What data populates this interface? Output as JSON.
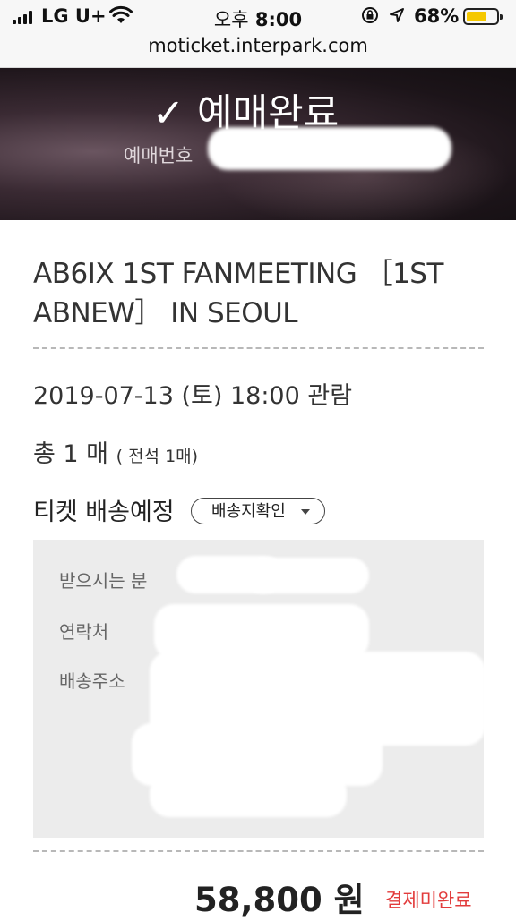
{
  "status_bar": {
    "carrier": "LG U+",
    "time_ampm": "오후",
    "time": "8:00",
    "battery_percent": "68%",
    "battery_level": 0.68,
    "battery_color": "#f5c800"
  },
  "browser": {
    "url": "moticket.interpark.com"
  },
  "header": {
    "check_mark": "✓",
    "title": "예매완료",
    "order_number_label": "예매번호"
  },
  "ticket": {
    "event_title": "AB6IX 1ST FANMEETING ［1ST ABNEW］ IN SEOUL",
    "date_time": "2019-07-13 (토) 18:00 관람",
    "count_main": "총 1 매",
    "count_sub": "( 전석 1매)",
    "delivery_label": "티켓 배송예정",
    "delivery_check_button": "배송지확인"
  },
  "address": {
    "recipient_label": "받으시는 분",
    "contact_label": "연락처",
    "address_label": "배송주소"
  },
  "payment": {
    "total": "58,800 원",
    "status": "결제미완료",
    "status_color": "#e23b3b"
  }
}
